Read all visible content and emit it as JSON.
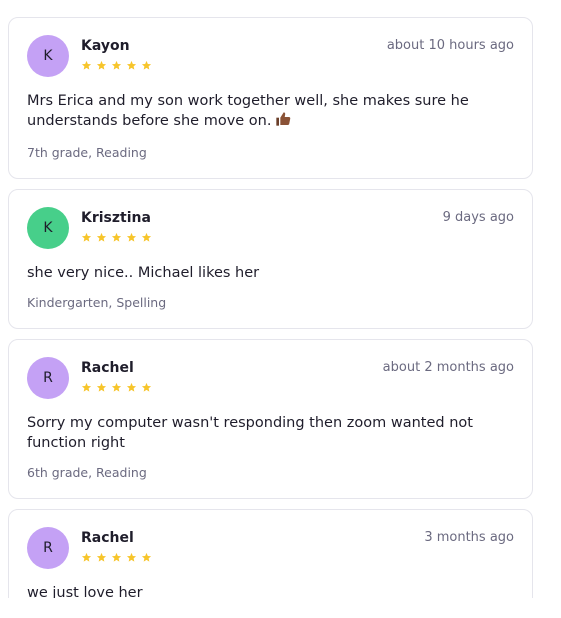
{
  "colors": {
    "star": "#f7c52b",
    "avatar_purple": "#c4a1f5",
    "avatar_green": "#47cf8a",
    "muted_text": "#6b6a80",
    "card_border": "#e5e5ec"
  },
  "reviews": [
    {
      "initial": "K",
      "avatar_color": "purple",
      "name": "Kayon",
      "rating": 5,
      "time": "about 10 hours ago",
      "comment": "Mrs Erica and my son work together well, she makes sure he understands before she move on.",
      "emoji": "thumbs-up-icon",
      "meta": "7th grade, Reading"
    },
    {
      "initial": "K",
      "avatar_color": "green",
      "name": "Krisztina",
      "rating": 5,
      "time": "9 days ago",
      "comment": "she very nice.. Michael likes her",
      "meta": "Kindergarten, Spelling"
    },
    {
      "initial": "R",
      "avatar_color": "purple",
      "name": "Rachel",
      "rating": 5,
      "time": "about 2 months ago",
      "comment": "Sorry my computer wasn't responding then zoom wanted not function right",
      "meta": "6th grade, Reading"
    },
    {
      "initial": "R",
      "avatar_color": "purple",
      "name": "Rachel",
      "rating": 5,
      "time": "3 months ago",
      "comment": "we just love her",
      "meta": ""
    }
  ]
}
